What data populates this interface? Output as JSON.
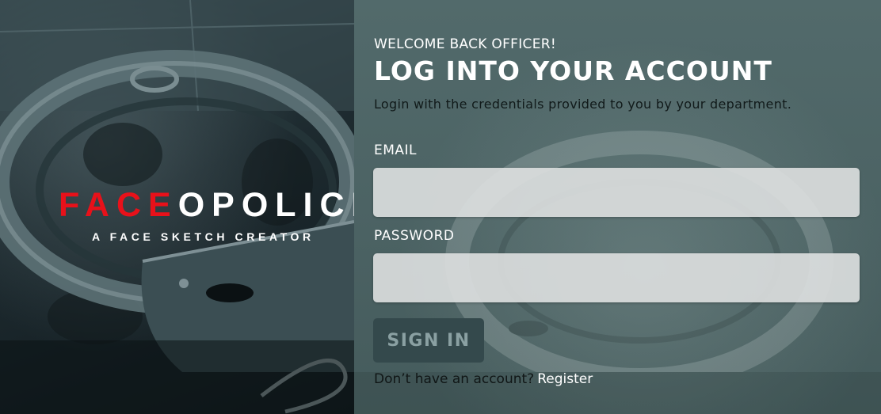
{
  "brand": {
    "logo_red": "FACE",
    "logo_white": "OPOLICE",
    "tagline": "A FACE SKETCH CREATOR"
  },
  "login": {
    "welcome": "WELCOME BACK OFFICER!",
    "title": "LOG INTO YOUR ACCOUNT",
    "subtitle": "Login with the credentials provided to you by your department.",
    "email_label": "EMAIL",
    "email_value": "",
    "password_label": "PASSWORD",
    "password_value": "",
    "signin_label": "SIGN IN",
    "no_account_text": "Don’t have an account?",
    "register_link": "Register"
  },
  "colors": {
    "logo_accent": "#e8111a",
    "panel_bg": "#4c6364",
    "button_bg": "#34494c"
  }
}
